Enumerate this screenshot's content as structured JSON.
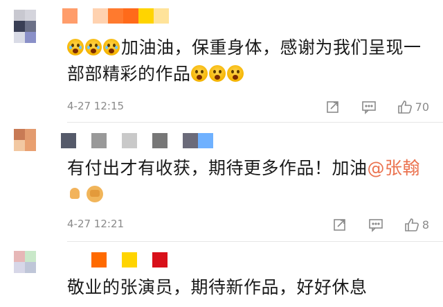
{
  "comments": [
    {
      "avatar_colors": [
        "#c8c8d0",
        "#d4d4dc",
        "#ffffff",
        "#3a3f55",
        "#6b7087",
        "#ffffff",
        "#d9dbe6",
        "#8a90c8",
        "#ffffff"
      ],
      "nickname_colors": [
        "#ff9d6b",
        "#ffffff",
        "#ffd2b0",
        "#ff7a2e",
        "#ff6a1a",
        "#ffd400",
        "#ffe39a"
      ],
      "text_before": "加油油，保重身体，感谢为我们呈现一部部精彩的作品",
      "emoji_leading_count": 3,
      "emoji_trailing_count": 3,
      "time": "4-27 12:15",
      "like_count": "70"
    },
    {
      "avatar_colors": [
        "#c87a55",
        "#e39b6f",
        "#ffffff",
        "#f2c8a2",
        "#e9a070",
        "#ffffff",
        "#ffffff",
        "#ffffff",
        "#ffffff"
      ],
      "nickname_colors": [
        "#555a6a",
        "#ffffff",
        "#999999",
        "#ffffff",
        "#c9c9c9",
        "#ffffff",
        "#777777",
        "#ffffff",
        "#6b6b7a",
        "#6fb1ff"
      ],
      "text": "有付出才有收获，期待更多作品！加油",
      "mention": "@张翰",
      "time": "4-27 12:21",
      "like_count": "8"
    },
    {
      "avatar_colors": [
        "#e7b7b7",
        "#c9e8c9",
        "#ffffff",
        "#d7d7e8",
        "#bfc6d8",
        "#ffffff",
        "#ffffff",
        "#ffffff",
        "#ffffff"
      ],
      "nickname_colors": [
        "#ff6a00",
        "#ffffff",
        "#ffd400",
        "#ffffff",
        "#d8101a"
      ],
      "text": "敬业的张演员，期待新作品，好好休息"
    }
  ],
  "icons": {
    "share": "share-icon",
    "comment": "comment-icon",
    "like": "like-icon"
  }
}
